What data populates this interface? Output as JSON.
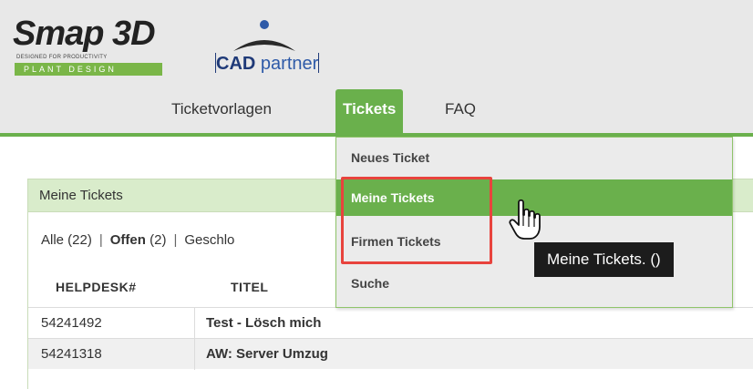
{
  "header": {
    "logo_smap": {
      "title": "Smap 3D",
      "tagline": "DESIGNED FOR PRODUCTIVITY",
      "bar_text": "PLANT DESIGN"
    },
    "logo_cad": {
      "bold": "CAD",
      "light": "partner"
    },
    "nav": [
      {
        "label": "Ticketvorlagen"
      },
      {
        "label": "Tickets",
        "active": true
      },
      {
        "label": "FAQ"
      }
    ]
  },
  "dropdown": {
    "items": [
      {
        "label": "Neues Ticket"
      },
      {
        "label": "Meine Tickets",
        "hover": true
      },
      {
        "label": "Firmen Tickets"
      },
      {
        "label": "Suche"
      }
    ]
  },
  "tooltip": {
    "text": "Meine Tickets. ()"
  },
  "panel": {
    "title": "Meine Tickets",
    "filters": [
      {
        "label": "Alle (22)"
      },
      {
        "label": "Offen (2)",
        "bold_part": "Offen",
        "count_part": " (2)"
      },
      {
        "label": "Geschlo"
      }
    ],
    "columns": [
      "HELPDESK#",
      "TITEL"
    ],
    "rows": [
      {
        "id": "54241492",
        "title": "Test  -  Lösch mich"
      },
      {
        "id": "54241318",
        "title": "AW: Server Umzug"
      }
    ]
  },
  "colors": {
    "accent": "#6ab04c",
    "panel_header": "#d9eccb",
    "highlight": "#e8433d",
    "tooltip_bg": "#1c1c1c"
  }
}
